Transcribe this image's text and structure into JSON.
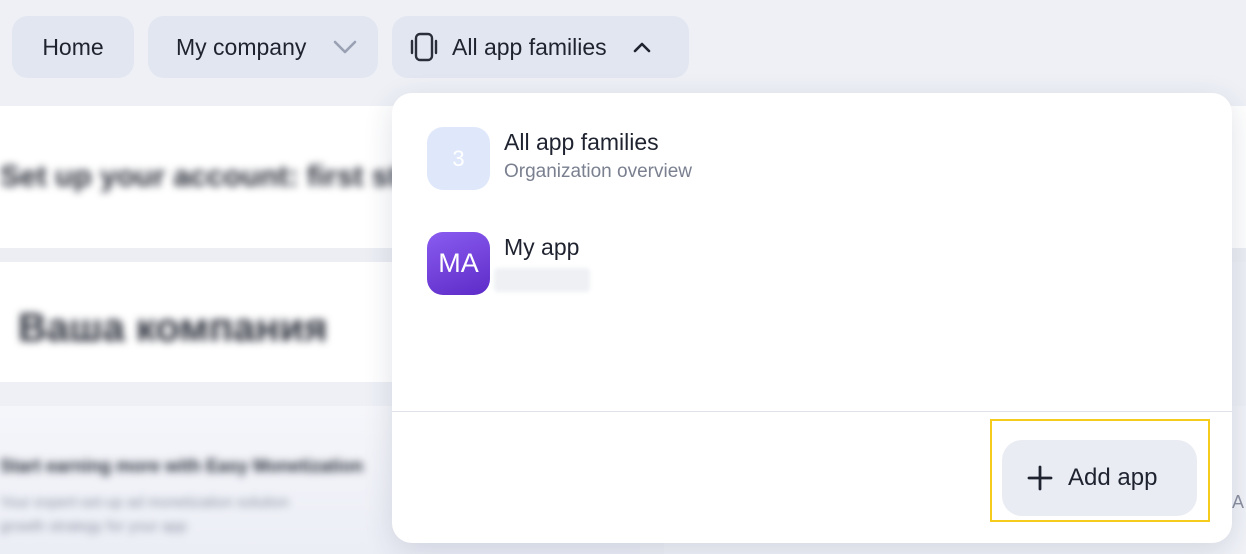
{
  "nav": {
    "home_label": "Home",
    "company_label": "My company",
    "families_label": "All app families"
  },
  "background": {
    "heading": "Set up your account: first steps",
    "company_heading": "Ваша компания",
    "promo_title": "Start earning more with Easy Monetization",
    "promo_line1": "Your expert-set-up ad monetization solution",
    "promo_line2": "growth strategy for your app",
    "edge_text": "A"
  },
  "dropdown": {
    "items": [
      {
        "badge": "3",
        "title": "All app families",
        "subtitle": "Organization overview"
      },
      {
        "badge": "MA",
        "title": "My app",
        "subtitle": ""
      }
    ],
    "add_label": "Add app"
  },
  "colors": {
    "highlight": "#f5cc1b",
    "app_badge": "#6a3bd8",
    "count_badge": "#dfe8fb"
  },
  "icons": [
    "chevron-down-icon",
    "chevron-up-icon",
    "phone-icon",
    "plus-icon"
  ]
}
